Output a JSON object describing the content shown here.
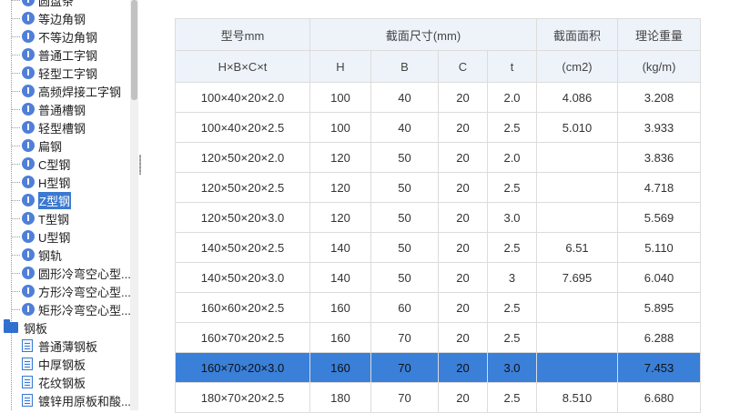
{
  "tree": {
    "items": [
      {
        "label": "圆盘条",
        "icon": "i-icon",
        "selected": false
      },
      {
        "label": "等边角钢",
        "icon": "i-icon",
        "selected": false
      },
      {
        "label": "不等边角钢",
        "icon": "i-icon",
        "selected": false
      },
      {
        "label": "普通工字钢",
        "icon": "i-icon",
        "selected": false
      },
      {
        "label": "轻型工字钢",
        "icon": "i-icon",
        "selected": false
      },
      {
        "label": "高频焊接工字钢",
        "icon": "i-icon",
        "selected": false
      },
      {
        "label": "普通槽钢",
        "icon": "i-icon",
        "selected": false
      },
      {
        "label": "轻型槽钢",
        "icon": "i-icon",
        "selected": false
      },
      {
        "label": "扁钢",
        "icon": "i-icon",
        "selected": false
      },
      {
        "label": "C型钢",
        "icon": "i-icon",
        "selected": false
      },
      {
        "label": "H型钢",
        "icon": "i-icon",
        "selected": false
      },
      {
        "label": "Z型钢",
        "icon": "i-icon",
        "selected": true
      },
      {
        "label": "T型钢",
        "icon": "i-icon",
        "selected": false
      },
      {
        "label": "U型钢",
        "icon": "i-icon",
        "selected": false
      },
      {
        "label": "钢轨",
        "icon": "i-icon",
        "selected": false
      },
      {
        "label": "圆形冷弯空心型...",
        "icon": "i-icon",
        "selected": false
      },
      {
        "label": "方形冷弯空心型...",
        "icon": "i-icon",
        "selected": false
      },
      {
        "label": "矩形冷弯空心型...",
        "icon": "i-icon",
        "selected": false
      }
    ],
    "folder": {
      "label": "钢板",
      "icon": "folder-icon"
    },
    "sub_items": [
      {
        "label": "普通薄钢板",
        "icon": "document-icon"
      },
      {
        "label": "中厚钢板",
        "icon": "document-icon"
      },
      {
        "label": "花纹钢板",
        "icon": "document-icon"
      },
      {
        "label": "镀锌用原板和酸...",
        "icon": "document-icon"
      }
    ]
  },
  "table": {
    "header": {
      "model": "型号mm",
      "dims": "截面尺寸(mm)",
      "area": "截面面积",
      "weight": "理论重量",
      "model_sub": "H×B×C×t",
      "h": "H",
      "b": "B",
      "c": "C",
      "t": "t",
      "area_unit": "(cm2)",
      "weight_unit": "(kg/m)"
    },
    "rows": [
      {
        "model": "100×40×20×2.0",
        "H": "100",
        "B": "40",
        "C": "20",
        "t": "2.0",
        "area": "4.086",
        "weight": "3.208"
      },
      {
        "model": "100×40×20×2.5",
        "H": "100",
        "B": "40",
        "C": "20",
        "t": "2.5",
        "area": "5.010",
        "weight": "3.933"
      },
      {
        "model": "120×50×20×2.0",
        "H": "120",
        "B": "50",
        "C": "20",
        "t": "2.0",
        "area": "",
        "weight": "3.836"
      },
      {
        "model": "120×50×20×2.5",
        "H": "120",
        "B": "50",
        "C": "20",
        "t": "2.5",
        "area": "",
        "weight": "4.718"
      },
      {
        "model": "120×50×20×3.0",
        "H": "120",
        "B": "50",
        "C": "20",
        "t": "3.0",
        "area": "",
        "weight": "5.569"
      },
      {
        "model": "140×50×20×2.5",
        "H": "140",
        "B": "50",
        "C": "20",
        "t": "2.5",
        "area": "6.51",
        "weight": "5.110"
      },
      {
        "model": "140×50×20×3.0",
        "H": "140",
        "B": "50",
        "C": "20",
        "t": "3",
        "area": "7.695",
        "weight": "6.040"
      },
      {
        "model": "160×60×20×2.5",
        "H": "160",
        "B": "60",
        "C": "20",
        "t": "2.5",
        "area": "",
        "weight": "5.895"
      },
      {
        "model": "160×70×20×2.5",
        "H": "160",
        "B": "70",
        "C": "20",
        "t": "2.5",
        "area": "",
        "weight": "6.288"
      },
      {
        "model": "160×70×20×3.0",
        "H": "160",
        "B": "70",
        "C": "20",
        "t": "3.0",
        "area": "",
        "weight": "7.453",
        "highlighted": true
      },
      {
        "model": "180×70×20×2.5",
        "H": "180",
        "B": "70",
        "C": "20",
        "t": "2.5",
        "area": "8.510",
        "weight": "6.680"
      }
    ]
  },
  "colors": {
    "selection": "#3a7fd8",
    "header_bg": "#eef3fa",
    "icon_blue": "#4f7fd8"
  }
}
